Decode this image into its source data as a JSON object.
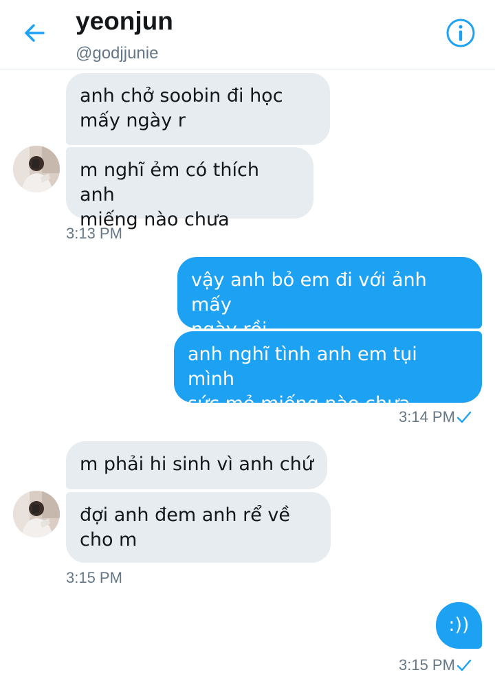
{
  "header": {
    "name": "yeonjun",
    "handle": "@godjjunie",
    "back_icon": "arrow-left-icon",
    "info_icon": "info-icon",
    "accent": "#1da1f2"
  },
  "messages": [
    {
      "side": "in",
      "text": "anh chở soobin đi học\nmấy ngày r"
    },
    {
      "side": "in",
      "text": "m nghĩ ẻm có thích anh\nmiếng nào chưa"
    },
    {
      "side": "out",
      "text": "vậy anh bỏ em đi với ảnh mấy\nngày rồi"
    },
    {
      "side": "out",
      "text": "anh nghĩ tình anh em tụi mình\nsức mẻ miếng nào chưa"
    },
    {
      "side": "in",
      "text": "m phải hi sinh vì anh chứ"
    },
    {
      "side": "in",
      "text": "đợi anh đem anh rể về\ncho m"
    },
    {
      "side": "out",
      "text": ":))"
    }
  ],
  "timestamps": [
    "3:13 PM",
    "3:14 PM",
    "3:15 PM",
    "3:15 PM"
  ],
  "read_icon": "checkmark-icon"
}
